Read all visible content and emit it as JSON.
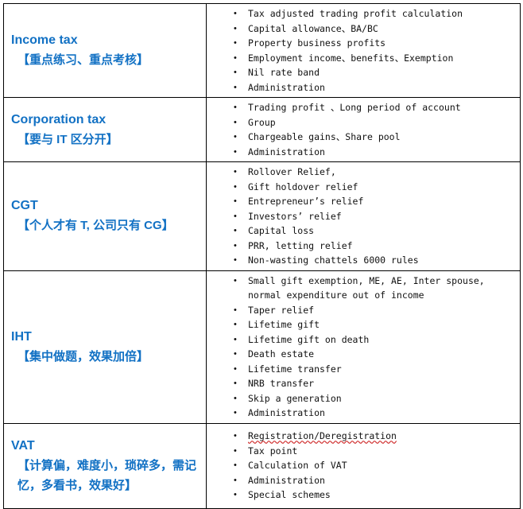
{
  "document": {
    "type": "study-plan-table",
    "accent_color": "#1271C4",
    "text_color": "#111111",
    "border_color": "#000000"
  },
  "rows": [
    {
      "topic": "Income tax",
      "note": "【重点练习、重点考核】",
      "points": [
        "Tax adjusted trading profit calculation",
        "Capital allowance、BA/BC",
        "Property business profits",
        "Employment income、benefits、Exemption",
        "Nil rate band",
        "Administration"
      ]
    },
    {
      "topic": "Corporation tax",
      "note": "【要与 IT 区分开】",
      "points": [
        "Trading profit 、Long period of account",
        "Group",
        "Chargeable gains、Share pool",
        "Administration"
      ]
    },
    {
      "topic": "CGT",
      "note": "【个人才有 T, 公司只有 CG】",
      "points": [
        "Rollover Relief,",
        "Gift holdover relief",
        "Entrepreneur’s relief",
        "Investors’  relief",
        "Capital loss",
        "PRR, letting relief",
        "Non-wasting chattels 6000 rules"
      ]
    },
    {
      "topic": "IHT",
      "note": "【集中做题，效果加倍】",
      "points": [
        "Small gift exemption, ME, AE, Inter spouse, normal expenditure out of income",
        "Taper relief",
        "Lifetime gift",
        "Lifetime gift on death",
        "Death estate",
        "Lifetime transfer",
        "NRB transfer",
        "Skip a generation",
        "Administration"
      ]
    },
    {
      "topic": "VAT",
      "note": "【计算偏，难度小，琐碎多，需记忆，多看书，效果好】",
      "points": [
        "Registration/Deregistration",
        "Tax point",
        "Calculation of VAT",
        "Administration",
        "Special schemes"
      ],
      "spellcheck_word": "Deregistration"
    }
  ]
}
